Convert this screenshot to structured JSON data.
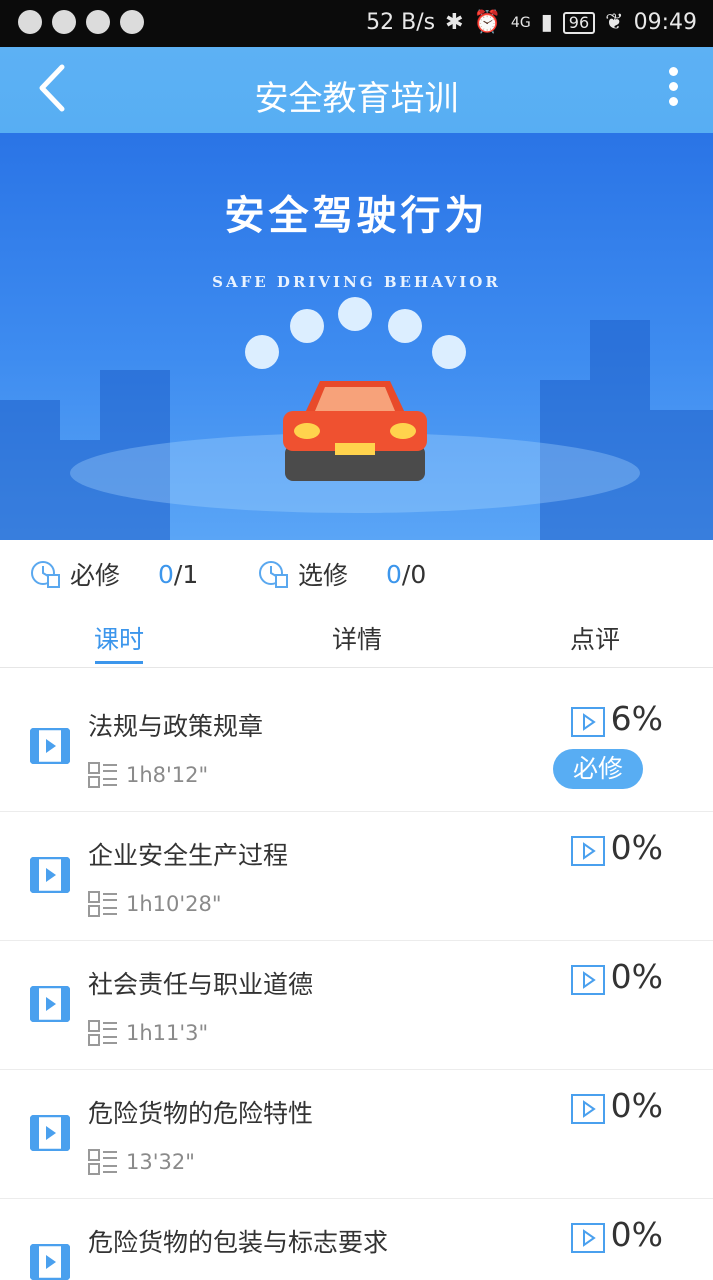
{
  "status_bar": {
    "network_speed": "52 B/s",
    "network_type": "4G",
    "battery": "96",
    "time": "09:49"
  },
  "header": {
    "title": "安全教育培训"
  },
  "banner": {
    "title": "安全驾驶行为",
    "subtitle": "SAFE DRIVING BEHAVIOR"
  },
  "stats": {
    "required": {
      "label": "必修",
      "done": "0",
      "total": "/1"
    },
    "elective": {
      "label": "选修",
      "done": "0",
      "total": "/0"
    }
  },
  "tabs": [
    {
      "label": "课时"
    },
    {
      "label": "详情"
    },
    {
      "label": "点评"
    }
  ],
  "courses": [
    {
      "name": "法规与政策规章",
      "duration": "1h8'12\"",
      "progress": "6%",
      "badge": "必修"
    },
    {
      "name": "企业安全生产过程",
      "duration": "1h10'28\"",
      "progress": "0%"
    },
    {
      "name": "社会责任与职业道德",
      "duration": "1h11'3\"",
      "progress": "0%"
    },
    {
      "name": "危险货物的危险特性",
      "duration": "13'32\"",
      "progress": "0%"
    },
    {
      "name": "危险货物的包装与标志要求",
      "duration": "",
      "progress": "0%"
    }
  ],
  "colors": {
    "accent": "#3c96ec",
    "header_bg": "#5db1f4",
    "badge_bg": "#58adf3"
  }
}
